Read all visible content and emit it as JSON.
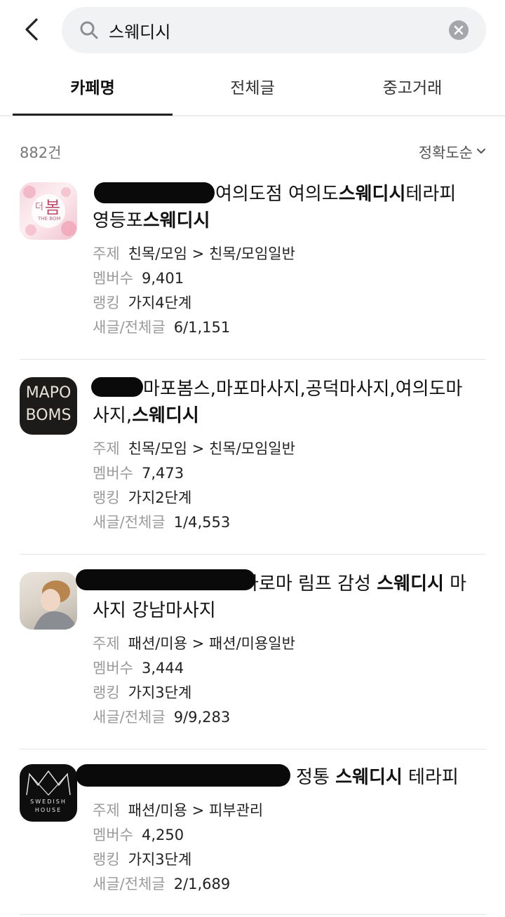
{
  "search": {
    "query": "스웨디시"
  },
  "tabs": [
    {
      "label": "카페명",
      "active": true
    },
    {
      "label": "전체글"
    },
    {
      "label": "중고거래"
    }
  ],
  "results": {
    "count": "882건",
    "sort": "정확도순"
  },
  "meta_labels": {
    "topic": "주제",
    "members": "멤버수",
    "ranking": "랭킹",
    "posts": "새글/전체글"
  },
  "items": [
    {
      "thumb_text": [
        "더",
        "봄"
      ],
      "thumb_small": "THE BOM",
      "title_prefix": "여의도점 여의도",
      "title_highlight": "스웨디시",
      "title_suffix": "테라피",
      "title_line2_prefix": "영등포",
      "title_line2_highlight": "스웨디시",
      "topic": "친목/모임 > 친목/모임일반",
      "members": "9,401",
      "ranking": "가지4단계",
      "posts": "6/1,151"
    },
    {
      "thumb_text": [
        "MAPO",
        "BOMS"
      ],
      "title_prefix": "마포봄스,마포마사지,공덕마사지,여의도마",
      "title_line2_prefix": "사지,",
      "title_line2_highlight": "스웨디시",
      "topic": "친목/모임 > 친목/모임일반",
      "members": "7,473",
      "ranking": "가지2단계",
      "posts": "1/4,553"
    },
    {
      "title_prefix": "아로마 림프 감성 ",
      "title_highlight": "스웨디시",
      "title_suffix": " 마",
      "title_line2_prefix": "사지 강남마사지",
      "topic": "패션/미용 > 패션/미용일반",
      "members": "3,444",
      "ranking": "가지3단계",
      "posts": "9/9,283"
    },
    {
      "thumb_text": [
        "SWEDISH",
        "HOUSE"
      ],
      "title_prefix": "정통 ",
      "title_highlight": "스웨디시",
      "title_suffix": " 테라피",
      "topic": "패션/미용 > 피부관리",
      "members": "4,250",
      "ranking": "가지3단계",
      "posts": "2/1,689"
    }
  ],
  "colors": {
    "text": "#111111",
    "meta": "#9a9a9a",
    "search_bg": "#f1f2f4",
    "divider": "#e4e4e4"
  }
}
